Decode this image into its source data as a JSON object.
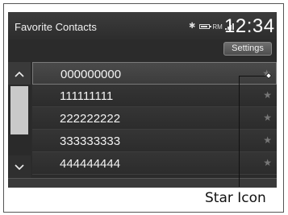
{
  "header": {
    "title": "Favorite Contacts",
    "time": "12:34",
    "bluetooth_icon": "bluetooth-icon",
    "battery_icon": "battery-icon",
    "signal_icon": "signal-icon",
    "mode_label": "RM"
  },
  "toolbar": {
    "settings_label": "Settings"
  },
  "contacts": [
    {
      "number": "000000000",
      "star": "★"
    },
    {
      "number": "111111111",
      "star": "★"
    },
    {
      "number": "222222222",
      "star": "★"
    },
    {
      "number": "333333333",
      "star": "★"
    },
    {
      "number": "444444444",
      "star": "★"
    }
  ],
  "scroll": {
    "up_glyph": "^",
    "down_glyph": "⌄"
  },
  "callout": {
    "label": "Star Icon"
  }
}
